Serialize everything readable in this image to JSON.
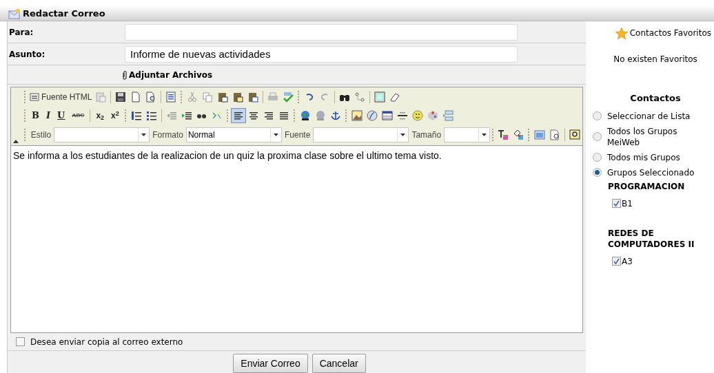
{
  "window": {
    "title": "Redactar Correo"
  },
  "form": {
    "to": {
      "label": "Para:"
    },
    "subject": {
      "label": "Asunto:",
      "value": "Informe de nuevas actividades"
    },
    "attach": {
      "label": "Adjuntar Archivos"
    }
  },
  "editor": {
    "source_label": "Fuente HTML",
    "format_buttons": [
      "B",
      "I",
      "U",
      "ABC"
    ],
    "script_buttons": [
      "x$_{2}$",
      "x$^{2}$"
    ],
    "alignment": [
      {
        "selected": true
      },
      {
        "selected": false
      },
      {
        "selected": false
      },
      {
        "selected": false
      }
    ],
    "selects": [
      {
        "label": "Estilo"
      },
      {
        "label": "Formato",
        "value": "Normal"
      },
      {
        "label": "Fuente"
      },
      {
        "label": "Tamaño"
      }
    ],
    "body": "Se informa a los estudiantes de la realizacion de un quiz la proxima clase sobre el ultimo tema visto."
  },
  "external_copy": {
    "label": "Desea enviar copia al correo externo",
    "checked": false
  },
  "buttons": [
    "Enviar Correo",
    "Cancelar"
  ],
  "sidebar": {
    "favorites_title": "Contactos Favoritos",
    "favorites_empty": "No existen Favoritos",
    "contacts_title": "Contactos",
    "options": [
      {
        "label": "Seleccionar de Lista",
        "selected": false
      },
      {
        "label": "Todos los Grupos MeiWeb",
        "selected": false
      },
      {
        "label": "Todos mis Grupos",
        "selected": false
      },
      {
        "label": "Grupos Seleccionado",
        "selected": true
      }
    ],
    "groups": [
      {
        "name": "PROGRAMACION",
        "items": [
          {
            "label": "B1",
            "checked": true
          }
        ]
      },
      {
        "name": "REDES DE COMPUTADORES II",
        "items": [
          {
            "label": "A3",
            "checked": true
          }
        ]
      }
    ]
  }
}
